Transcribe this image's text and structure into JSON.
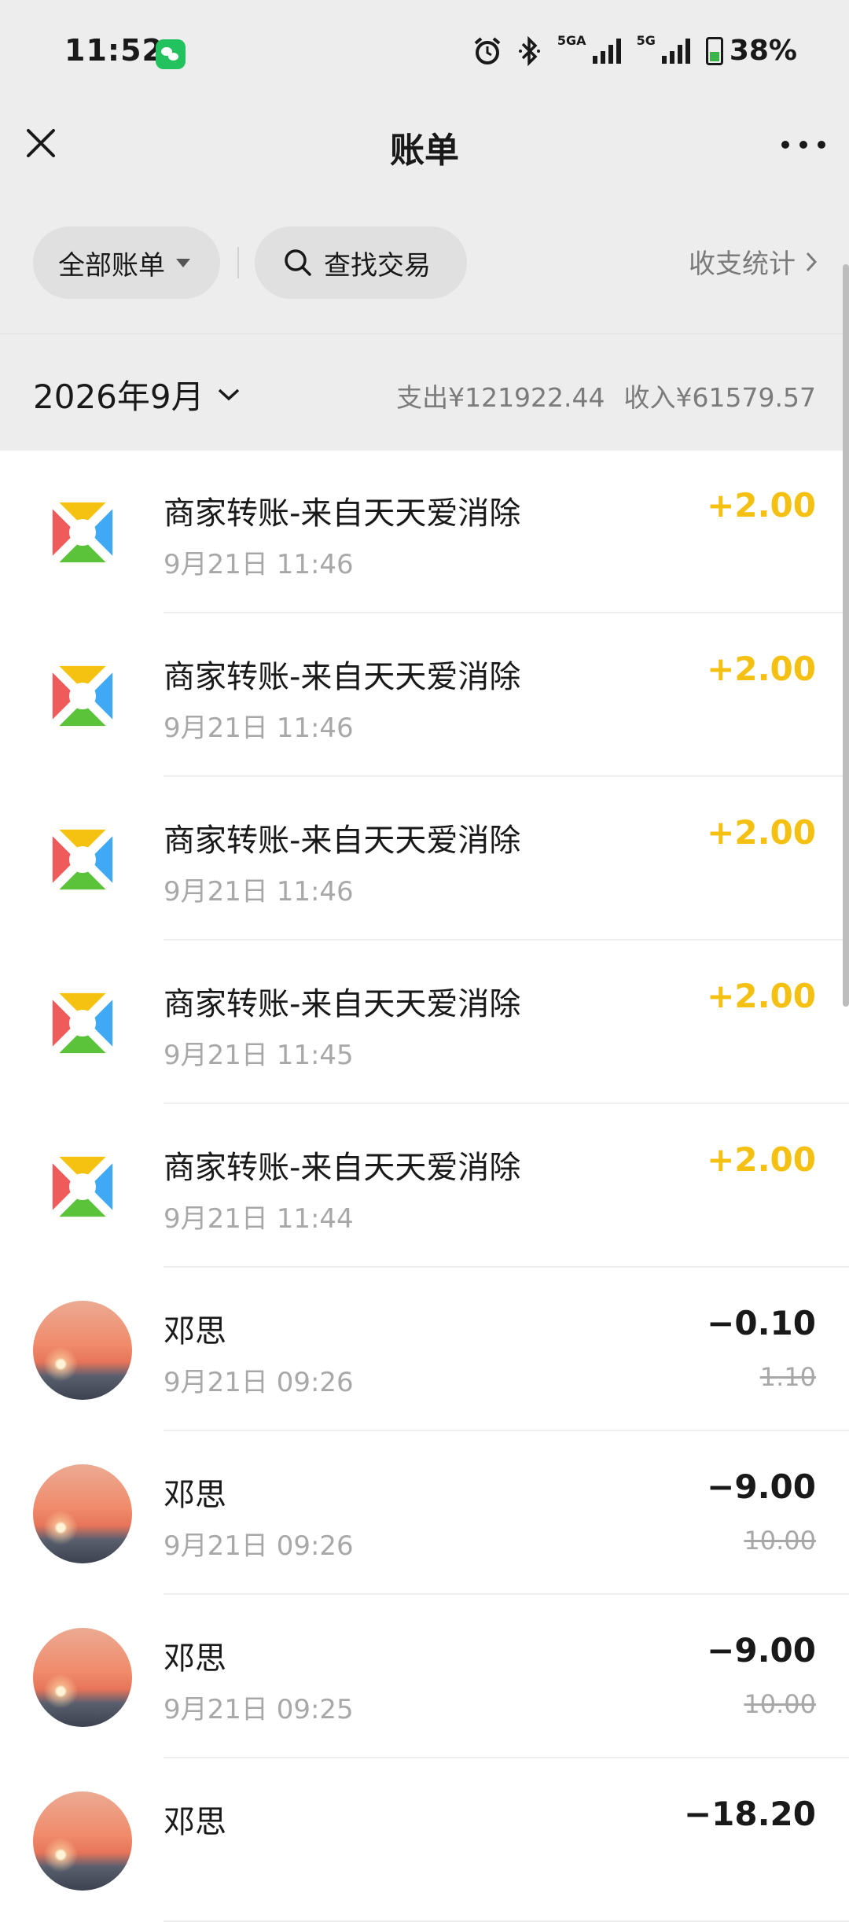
{
  "status_bar": {
    "time": "11:52",
    "battery": "38%",
    "network_tag": "5GA",
    "network_tag2": "5G"
  },
  "header": {
    "title": "账单"
  },
  "filters": {
    "all_bills": "全部账单",
    "search": "查找交易",
    "stats": "收支统计"
  },
  "month_bar": {
    "month": "2026年9月",
    "expense": "支出¥121922.44",
    "income": "收入¥61579.57"
  },
  "colors": {
    "income_amount": "#f4c112",
    "page_bg": "#ededed"
  },
  "transactions": [
    {
      "name": "商家转账-来自天天爱消除",
      "date": "9月21日 11:46",
      "amount": "+2.00",
      "original": "",
      "type": "income",
      "icon": "merchant-logo-icon"
    },
    {
      "name": "商家转账-来自天天爱消除",
      "date": "9月21日 11:46",
      "amount": "+2.00",
      "original": "",
      "type": "income",
      "icon": "merchant-logo-icon"
    },
    {
      "name": "商家转账-来自天天爱消除",
      "date": "9月21日 11:46",
      "amount": "+2.00",
      "original": "",
      "type": "income",
      "icon": "merchant-logo-icon"
    },
    {
      "name": "商家转账-来自天天爱消除",
      "date": "9月21日 11:45",
      "amount": "+2.00",
      "original": "",
      "type": "income",
      "icon": "merchant-logo-icon"
    },
    {
      "name": "商家转账-来自天天爱消除",
      "date": "9月21日 11:44",
      "amount": "+2.00",
      "original": "",
      "type": "income",
      "icon": "merchant-logo-icon"
    },
    {
      "name": "邓思",
      "date": "9月21日 09:26",
      "amount": "−0.10",
      "original": "1.10",
      "type": "expense",
      "icon": "sunset-avatar"
    },
    {
      "name": "邓思",
      "date": "9月21日 09:26",
      "amount": "−9.00",
      "original": "10.00",
      "type": "expense",
      "icon": "sunset-avatar"
    },
    {
      "name": "邓思",
      "date": "9月21日 09:25",
      "amount": "−9.00",
      "original": "10.00",
      "type": "expense",
      "icon": "sunset-avatar"
    },
    {
      "name": "邓思",
      "date": "",
      "amount": "−18.20",
      "original": "",
      "type": "expense",
      "icon": "sunset-avatar"
    }
  ]
}
